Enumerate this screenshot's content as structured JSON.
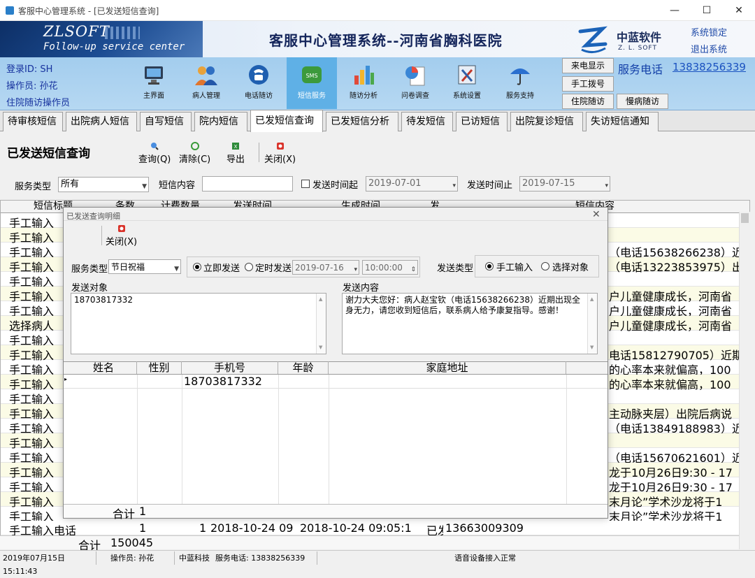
{
  "window": {
    "title": "客服中心管理系统 - [已发送短信查询]",
    "minimize": "—",
    "maximize": "☐",
    "close": "✕"
  },
  "banner": {
    "logo_title": "ZLSOFT",
    "logo_subtitle": "Follow-up service center",
    "system_title": "客服中心管理系统--河南省胸科医院",
    "vendor_name": "中蓝软件",
    "vendor_sub": "Z. L. SOFT",
    "lock_link": "系统锁定",
    "exit_link": "退出系统"
  },
  "user": {
    "login_id": "登录ID: SH",
    "operator": "操作员: 孙花",
    "role": "住院随访操作员"
  },
  "toolbar": {
    "items": [
      {
        "label": "主界面",
        "icon": "monitor-icon"
      },
      {
        "label": "病人管理",
        "icon": "users-icon"
      },
      {
        "label": "电话随访",
        "icon": "telephone-icon"
      },
      {
        "label": "短信服务",
        "icon": "sms-icon"
      },
      {
        "label": "随访分析",
        "icon": "bar-chart-icon"
      },
      {
        "label": "问卷调查",
        "icon": "pie-document-icon"
      },
      {
        "label": "系统设置",
        "icon": "tools-icon"
      },
      {
        "label": "服务支持",
        "icon": "umbrella-icon"
      }
    ],
    "active_index": 3,
    "side_buttons": [
      "来电显示",
      "手工拨号",
      "住院随访",
      "慢病随访"
    ],
    "phone_label": "服务电话",
    "phone_number": "13838256339"
  },
  "tabs": [
    "待审核短信",
    "出院病人短信",
    "自写短信",
    "院内短信",
    "已发短信查询",
    "已发短信分析",
    "待发短信",
    "已访短信",
    "出院复诊短信",
    "失访短信通知"
  ],
  "selected_tab": 4,
  "page": {
    "title": "已发送短信查询",
    "actions": {
      "query": "查询(Q)",
      "clear": "清除(C)",
      "export": "导出",
      "close": "关闭(X)"
    }
  },
  "filters": {
    "service_type_label": "服务类型",
    "service_type_value": "所有",
    "content_label": "短信内容",
    "content_value": "",
    "send_from_label": "发送时间起",
    "send_from_value": "2019-07-01",
    "send_to_label": "发送时间止",
    "send_to_value": "2019-07-15"
  },
  "grid": {
    "columns": [
      "短信标题",
      "条数",
      "计费数量",
      "发送时间",
      "生成时间",
      "发",
      "短信内容"
    ],
    "rows": [
      {
        "title": "手工输入",
        "content": ""
      },
      {
        "title": "手工输入",
        "content": ""
      },
      {
        "title": "手工输入",
        "content": "（电话15638266238）近"
      },
      {
        "title": "手工输入",
        "content": "（电话13223853975）出"
      },
      {
        "title": "手工输入",
        "content": ""
      },
      {
        "title": "手工输入",
        "content": "户儿童健康成长，河南省"
      },
      {
        "title": "手工输入",
        "content": "户儿童健康成长，河南省"
      },
      {
        "title": "选择病人",
        "content": "户儿童健康成长，河南省"
      },
      {
        "title": "手工输入",
        "content": ""
      },
      {
        "title": "手工输入",
        "content": "电话15812790705）近期"
      },
      {
        "title": "手工输入",
        "content": "的心率本来就偏高，100"
      },
      {
        "title": "手工输入",
        "content": "的心率本来就偏高，100"
      },
      {
        "title": "手工输入",
        "content": ""
      },
      {
        "title": "手工输入",
        "content": "主动脉夹层）出院后病说"
      },
      {
        "title": "手工输入",
        "content": "（电话13849188983）近"
      },
      {
        "title": "手工输入",
        "content": ""
      },
      {
        "title": "手工输入",
        "content": "（电话15670621601）近"
      },
      {
        "title": "手工输入",
        "content": "龙于10月26日9:30 - 17"
      },
      {
        "title": "手工输入",
        "content": "龙于10月26日9:30 - 17"
      },
      {
        "title": "手工输入",
        "content": "末月论”学术沙龙将于1"
      },
      {
        "title": "手工输入",
        "content": "末月论”学术沙龙将于1"
      }
    ],
    "last_row": {
      "title": "手工输入电话",
      "count": "1",
      "billing": "1",
      "send_time": "2018-10-24 09",
      "gen_time": "2018-10-24 09:05:1",
      "sent": "已发",
      "content": "13663009309"
    },
    "total_label": "合计",
    "total_value": "150045"
  },
  "status": {
    "datetime": "2019年07月15日 15:11:43",
    "operator": "操作员: 孙花",
    "company": "中蓝科技",
    "service_phone": "服务电话: 13838256339",
    "voice": "语音设备接入正常"
  },
  "dialog": {
    "title": "已发送查询明细",
    "close_label": "关闭(X)",
    "service_type_label": "服务类型",
    "service_type_value": "节日祝福",
    "send_now": "立即发送",
    "send_timed": "定时发送",
    "date_value": "2019-07-16",
    "time_value": "10:00:00",
    "send_kind_label": "发送类型",
    "manual_input": "手工输入",
    "select_target": "选择对象",
    "target_label": "发送对象",
    "target_value": "18703817332",
    "content_label": "发送内容",
    "content_value": "谢力大夫您好：病人赵宝钦（电话15638266238）近期出现全身无力，请您收到短信后，联系病人给予康复指导。感谢！",
    "columns": [
      "姓名",
      "性别",
      "手机号",
      "年龄",
      "家庭地址"
    ],
    "row": {
      "phone": "18703817332"
    },
    "total_label": "合计",
    "total_value": "1"
  }
}
